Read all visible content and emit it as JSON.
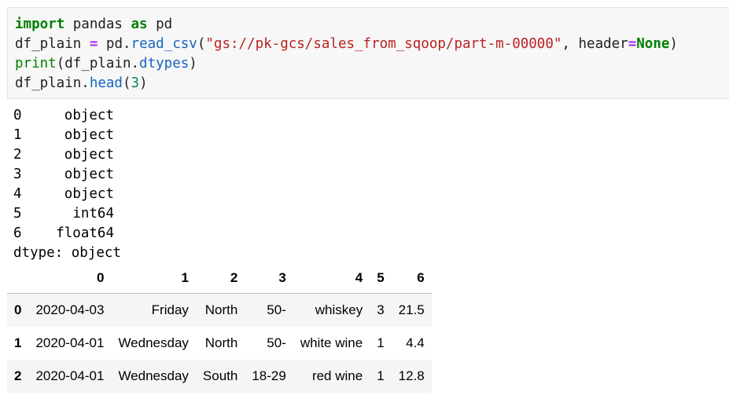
{
  "code": {
    "l1": {
      "import": "import",
      "t1": " pandas ",
      "as": "as",
      "t2": " pd"
    },
    "l2": {
      "t1": "df_plain ",
      "eq": "=",
      "t2": " pd.",
      "fn": "read_csv",
      "t3": "(",
      "str": "\"gs://pk-gcs/sales_from_sqoop/part-m-00000\"",
      "t4": ", header",
      "eq2": "=",
      "none": "None",
      "t5": ")"
    },
    "l3": {
      "print": "print",
      "t1": "(df_plain.",
      "fn": "dtypes",
      "t2": ")"
    },
    "l4": {
      "t1": "df_plain.",
      "fn": "head",
      "t2": "(",
      "num": "3",
      "t3": ")"
    }
  },
  "dtypes": [
    {
      "idx": "0",
      "type": "object"
    },
    {
      "idx": "1",
      "type": "object"
    },
    {
      "idx": "2",
      "type": "object"
    },
    {
      "idx": "3",
      "type": "object"
    },
    {
      "idx": "4",
      "type": "object"
    },
    {
      "idx": "5",
      "type": "int64"
    },
    {
      "idx": "6",
      "type": "float64"
    }
  ],
  "dtype_footer": "dtype: object",
  "table": {
    "columns": [
      "0",
      "1",
      "2",
      "3",
      "4",
      "5",
      "6"
    ],
    "rows": [
      {
        "index": "0",
        "cells": [
          "2020-04-03",
          "Friday",
          "North",
          "50-",
          "whiskey",
          "3",
          "21.5"
        ]
      },
      {
        "index": "1",
        "cells": [
          "2020-04-01",
          "Wednesday",
          "North",
          "50-",
          "white wine",
          "1",
          "4.4"
        ]
      },
      {
        "index": "2",
        "cells": [
          "2020-04-01",
          "Wednesday",
          "South",
          "18-29",
          "red wine",
          "1",
          "12.8"
        ]
      }
    ]
  }
}
